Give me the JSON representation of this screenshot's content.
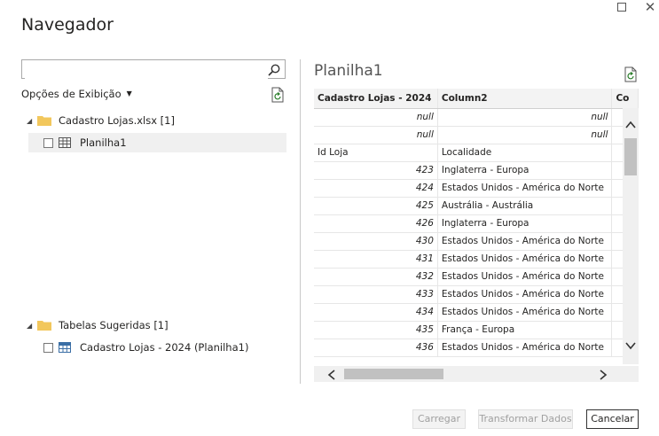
{
  "window": {
    "title": "Navegador"
  },
  "search": {
    "value": "",
    "placeholder": ""
  },
  "options": {
    "label": "Opções de Exibição"
  },
  "tree": {
    "file": {
      "label": "Cadastro Lojas.xlsx [1]",
      "children": [
        {
          "label": "Planilha1"
        }
      ]
    },
    "suggested": {
      "label": "Tabelas Sugeridas [1]",
      "children": [
        {
          "label": "Cadastro Lojas - 2024 (Planilha1)"
        }
      ]
    }
  },
  "preview": {
    "title": "Planilha1",
    "columns": [
      "Cadastro Lojas - 2024",
      "Column2",
      "Co"
    ],
    "rows": [
      [
        "null",
        "null"
      ],
      [
        "null",
        "null"
      ],
      [
        "Id Loja",
        "Localidade"
      ],
      [
        "423",
        "Inglaterra - Europa"
      ],
      [
        "424",
        "Estados Unidos - América do Norte"
      ],
      [
        "425",
        "Austrália - Austrália"
      ],
      [
        "426",
        "Inglaterra - Europa"
      ],
      [
        "430",
        "Estados Unidos - América do Norte"
      ],
      [
        "431",
        "Estados Unidos - América do Norte"
      ],
      [
        "432",
        "Estados Unidos - América do Norte"
      ],
      [
        "433",
        "Estados Unidos - América do Norte"
      ],
      [
        "434",
        "Estados Unidos - América do Norte"
      ],
      [
        "435",
        "França - Europa"
      ],
      [
        "436",
        "Estados Unidos - América do Norte"
      ]
    ]
  },
  "buttons": {
    "load": "Carregar",
    "transform": "Transformar Dados",
    "cancel": "Cancelar"
  },
  "colors": {
    "folder": "#f2c75c",
    "accent": "#333333"
  }
}
